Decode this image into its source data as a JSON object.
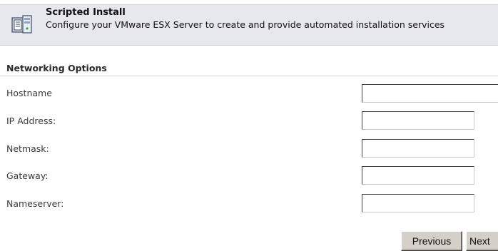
{
  "header": {
    "title": "Scripted Install",
    "description": "Configure your VMware ESX Server to create and provide automated installation services",
    "icon": "server-document-icon"
  },
  "section": {
    "title": "Networking Options"
  },
  "fields": [
    {
      "label": "Hostname",
      "value": ""
    },
    {
      "label": "IP Address:",
      "value": ""
    },
    {
      "label": "Netmask:",
      "value": ""
    },
    {
      "label": "Gateway:",
      "value": ""
    },
    {
      "label": "Nameserver:",
      "value": ""
    }
  ],
  "buttons": {
    "previous": "Previous",
    "next": "Next"
  },
  "colors": {
    "header_bg": "#e7e7ee",
    "button_face": "#d4d0c8"
  }
}
